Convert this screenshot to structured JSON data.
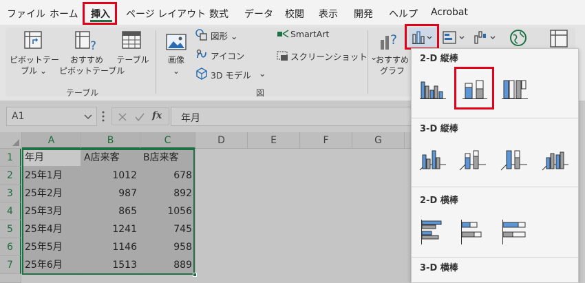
{
  "menu": {
    "items": [
      "ファイル",
      "ホーム",
      "挿入",
      "ページ レイアウト",
      "数式",
      "データ",
      "校閲",
      "表示",
      "開発",
      "ヘルプ",
      "Acrobat"
    ],
    "active": "挿入"
  },
  "ribbon": {
    "pivot_table": [
      "ピボットテー",
      "ブル ⌄"
    ],
    "recommended_pivot": [
      "おすすめ",
      "ピボットテーブル"
    ],
    "table": "テーブル",
    "tables_group": "テーブル",
    "image": [
      "画像",
      "⌄"
    ],
    "shapes": "図形 ⌄",
    "icons": "アイコン",
    "models3d": "3D モデル",
    "models3d_arrow": "⌄",
    "smartart": "SmartArt",
    "screenshot": "スクリーンショット ⌄",
    "illustrations_group": "図",
    "recommended_charts": [
      "おすすめ",
      "グラフ"
    ]
  },
  "formula_bar": {
    "name_box": "A1",
    "fx": "fx",
    "value": "年月"
  },
  "sheet": {
    "columns": [
      "A",
      "B",
      "C",
      "D",
      "E",
      "F",
      "G"
    ],
    "rows": [
      [
        "1",
        "年月",
        "A店来客",
        "B店来客"
      ],
      [
        "2",
        "25年1月",
        "1012",
        "678"
      ],
      [
        "3",
        "25年2月",
        "987",
        "892"
      ],
      [
        "4",
        "25年3月",
        "865",
        "1056"
      ],
      [
        "5",
        "25年4月",
        "1241",
        "745"
      ],
      [
        "6",
        "25年5月",
        "1146",
        "958"
      ],
      [
        "7",
        "25年6月",
        "1513",
        "889"
      ]
    ]
  },
  "chart_menu": {
    "section1": "2-D 縦棒",
    "section2": "3-D 縦棒",
    "section3": "2-D 横棒",
    "section4": "3-D 横棒"
  },
  "colors": {
    "accent_red": "#e0001a",
    "excel_green": "#1e7145",
    "chart_blue": "#4a90d9",
    "chart_gray": "#a0a0a0"
  }
}
